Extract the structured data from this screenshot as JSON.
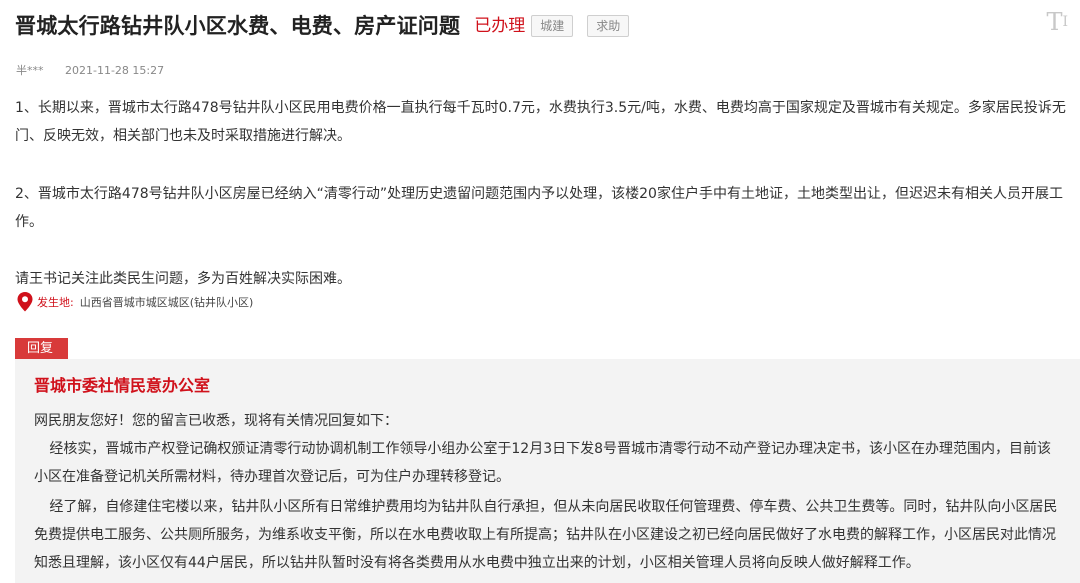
{
  "header": {
    "title": "晋城太行路钻井队小区水费、电费、房产证问题",
    "status": "已办理",
    "tags": [
      "城建",
      "求助"
    ],
    "font_toggle": "T",
    "font_toggle_small": "I"
  },
  "meta": {
    "author": "半***",
    "datetime": "2021-11-28 15:27"
  },
  "content": {
    "paragraphs": [
      "1、长期以来，晋城市太行路478号钻井队小区民用电费价格一直执行每千瓦时0.7元，水费执行3.5元/吨，水费、电费均高于国家规定及晋城市有关规定。多家居民投诉无门、反映无效，相关部门也未及时采取措施进行解决。",
      "2、晋城市太行路478号钻井队小区房屋已经纳入“清零行动”处理历史遗留问题范围内予以处理，该楼20家住户手中有土地证，土地类型出让，但迟迟未有相关人员开展工作。",
      "请王书记关注此类民生问题，多为百姓解决实际困难。"
    ]
  },
  "location": {
    "icon": "location-pin-icon",
    "label": "发生地:",
    "text": "山西省晋城市城区城区(钻井队小区)"
  },
  "reply": {
    "badge": "回复",
    "department": "晋城市委社情民意办公室",
    "greeting": "网民朋友您好！您的留言已收悉，现将有关情况回复如下：",
    "paragraphs": [
      "经核实，晋城市产权登记确权颁证清零行动协调机制工作领导小组办公室于12月3日下发8号晋城市清零行动不动产登记办理决定书，该小区在办理范围内，目前该小区在准备登记机关所需材料，待办理首次登记后，可为住户办理转移登记。",
      "经了解，自修建住宅楼以来，钻井队小区所有日常维护费用均为钻井队自行承担，但从未向居民收取任何管理费、停车费、公共卫生费等。同时，钻井队向小区居民免费提供电工服务、公共厕所服务，为维系收支平衡，所以在水电费收取上有所提高；钻井队在小区建设之初已经向居民做好了水电费的解释工作，小区居民对此情况知悉且理解，该小区仅有44户居民，所以钻井队暂时没有将各类费用从水电费中独立出来的计划，小区相关管理人员将向反映人做好解释工作。"
    ]
  },
  "colors": {
    "accent_red": "#d0111b",
    "badge_red": "#d83a3a",
    "reply_bg": "#f3f3f3"
  }
}
